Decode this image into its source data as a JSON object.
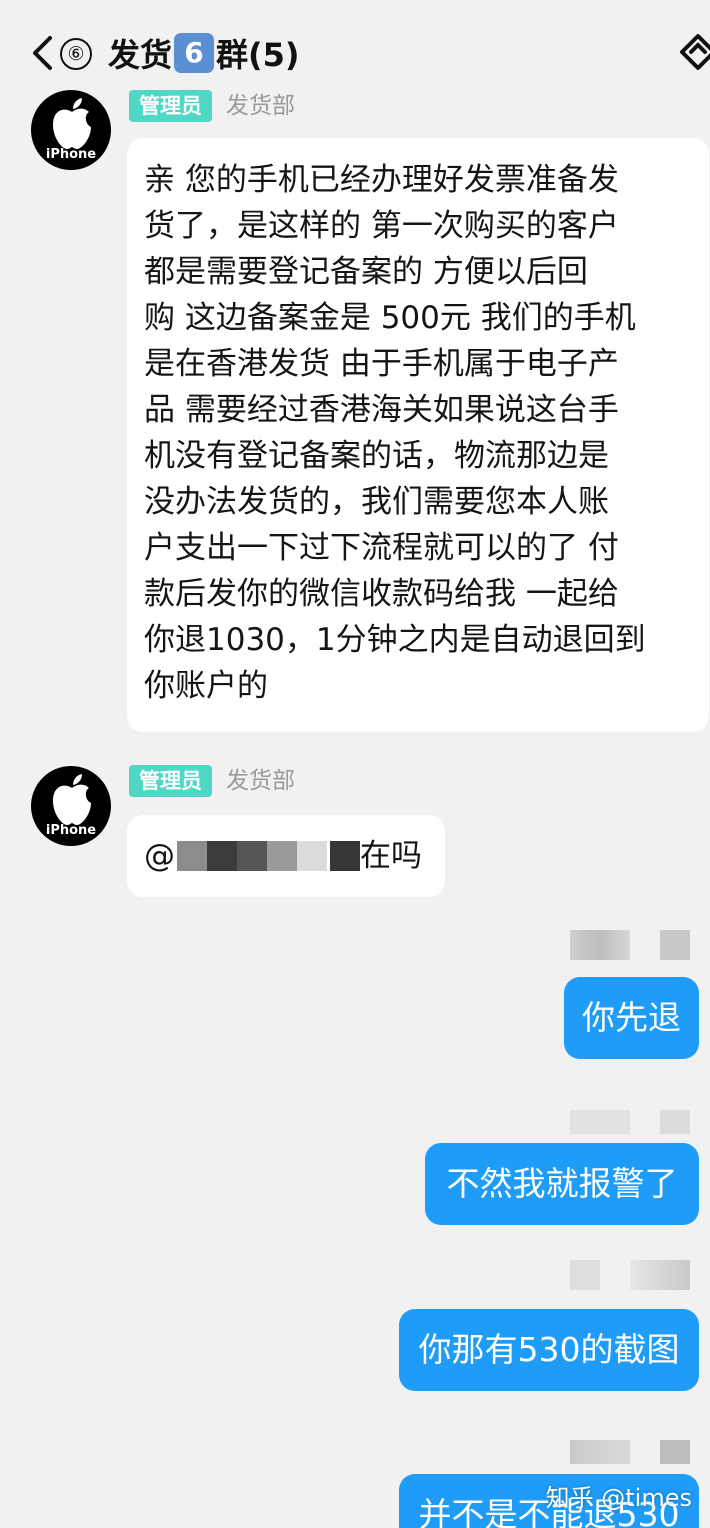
{
  "header": {
    "unread_count": "⑥",
    "title_prefix": "发货",
    "title_badge": "6",
    "title_suffix": "群(5)"
  },
  "messages_in": [
    {
      "avatar_label": "iPhone",
      "role": "管理员",
      "dept": "发货部",
      "lines": [
        "亲 您的手机已经办理好发票准备发",
        "货了，是这样的 第一次购买的客户",
        "都是需要登记备案的 方便以后回",
        "购 这边备案金是 500元 我们的手机",
        "是在香港发货 由于手机属于电子产",
        "品 需要经过香港海关如果说这台手",
        "机没有登记备案的话，物流那边是",
        "没办法发货的，我们需要您本人账",
        "户支出一下过下流程就可以的了 付",
        "款后发你的微信收款码给我 一起给",
        "你退1030，1分钟之内是自动退回到",
        "你账户的"
      ]
    },
    {
      "avatar_label": "iPhone",
      "role": "管理员",
      "dept": "发货部",
      "mention": "@",
      "text": "在吗"
    }
  ],
  "messages_out": [
    "你先退",
    "不然我就报警了",
    "你那有530的截图",
    "并不是不能退530"
  ],
  "watermark": "知乎 @times",
  "colors": {
    "background": "#f1f1f1",
    "outgoing_bubble": "#1e9cf8",
    "role_tag": "#4fd8c5",
    "badge": "#5b8fd3"
  }
}
